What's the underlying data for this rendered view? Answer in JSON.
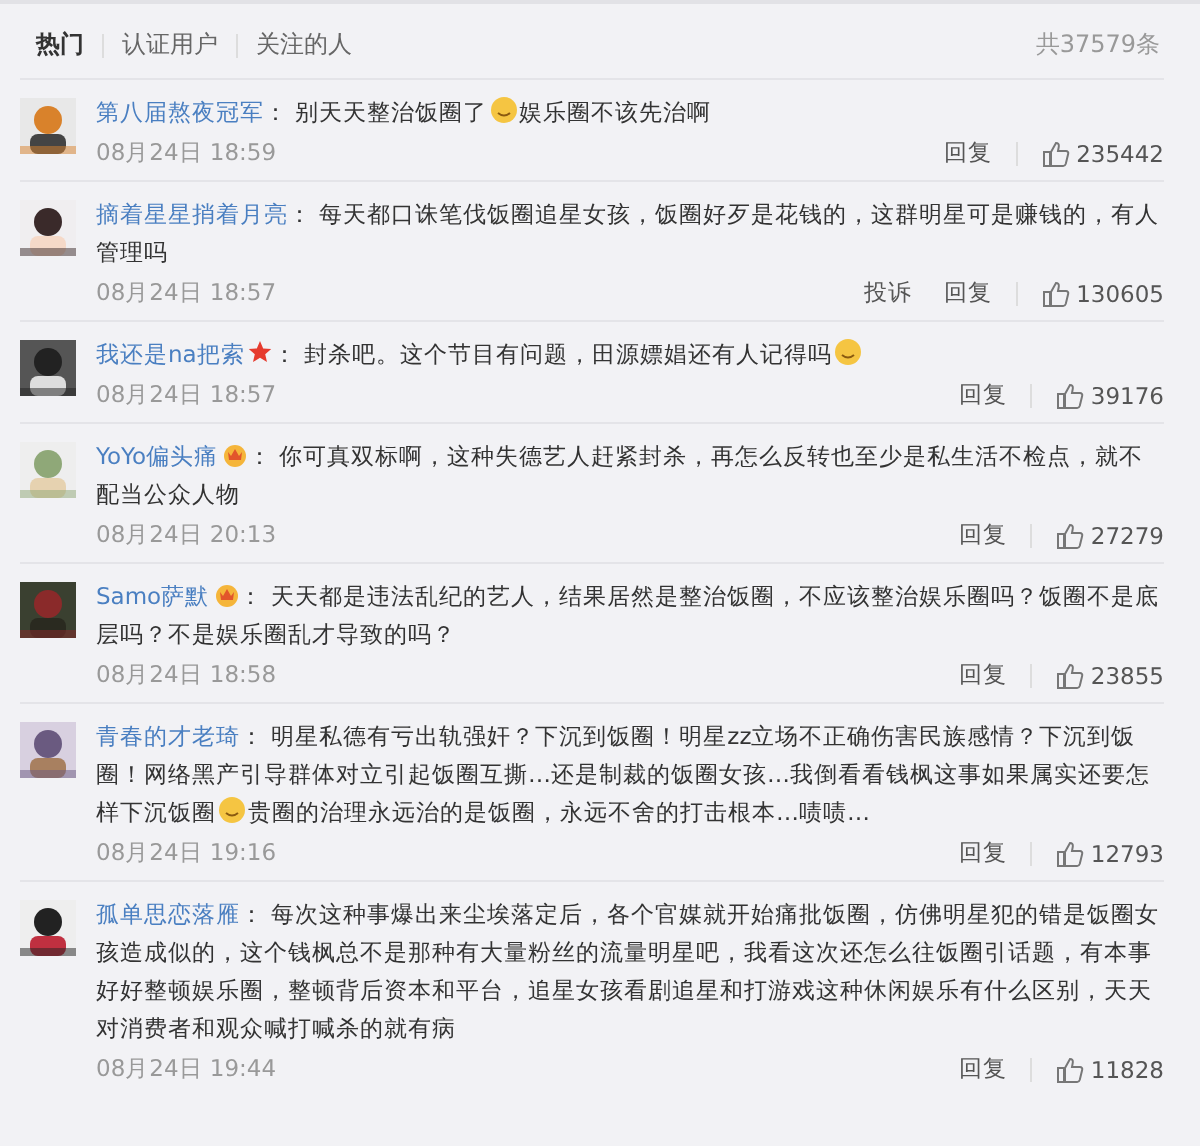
{
  "tabs": [
    {
      "label": "热门",
      "selected": true
    },
    {
      "label": "认证用户",
      "selected": false
    },
    {
      "label": "关注的人",
      "selected": false
    }
  ],
  "total": "共37579条",
  "comments": [
    {
      "user": "第八届熬夜冠军",
      "separator": "：",
      "parts": [
        {
          "kind": "text",
          "text": "别天天整治饭圈了"
        },
        {
          "kind": "emoji"
        },
        {
          "kind": "text",
          "text": "娱乐圈不该先治啊"
        }
      ],
      "time": "08月24日 18:59",
      "actions": [
        "回复"
      ],
      "likes": "235442"
    },
    {
      "user": "摘着星星捎着月亮",
      "separator": "：",
      "parts": [
        {
          "kind": "text",
          "text": "每天都口诛笔伐饭圈追星女孩，饭圈好歹是花钱的，这群明星可是赚钱的，有人管理吗"
        }
      ],
      "time": "08月24日 18:57",
      "actions": [
        "投诉",
        "回复"
      ],
      "likes": "130605"
    },
    {
      "user": "我还是na把索",
      "badge": {
        "kind": "star"
      },
      "separator": "：",
      "parts": [
        {
          "kind": "text",
          "text": "封杀吧。这个节目有问题，田源嫖娼还有人记得吗"
        },
        {
          "kind": "emoji"
        }
      ],
      "time": "08月24日 18:57",
      "actions": [
        "回复"
      ],
      "likes": "39176"
    },
    {
      "user": "YoYo偏头痛",
      "badge": {
        "kind": "crown"
      },
      "separator": "：",
      "parts": [
        {
          "kind": "text",
          "text": "你可真双标啊，这种失德艺人赶紧封杀，再怎么反转也至少是私生活不检点，就不配当公众人物"
        }
      ],
      "time": "08月24日 20:13",
      "actions": [
        "回复"
      ],
      "likes": "27279"
    },
    {
      "user": "Samo萨默",
      "badge": {
        "kind": "crown"
      },
      "separator": "：",
      "parts": [
        {
          "kind": "text",
          "text": "天天都是违法乱纪的艺人，结果居然是整治饭圈，不应该整治娱乐圈吗？饭圈不是底层吗？不是娱乐圈乱才导致的吗？"
        }
      ],
      "time": "08月24日 18:58",
      "actions": [
        "回复"
      ],
      "likes": "23855"
    },
    {
      "user": "青春的才老琦",
      "separator": "：",
      "parts": [
        {
          "kind": "text",
          "text": "明星私德有亏出轨强奸？下沉到饭圈！明星zz立场不正确伤害民族感情？下沉到饭圈！网络黑产引导群体对立引起饭圈互撕…还是制裁的饭圈女孩…我倒看看钱枫这事如果属实还要怎样下沉饭圈"
        },
        {
          "kind": "emoji"
        },
        {
          "kind": "text",
          "text": "贵圈的治理永远治的是饭圈，永远不舍的打击根本…啧啧…"
        }
      ],
      "time": "08月24日 19:16",
      "actions": [
        "回复"
      ],
      "likes": "12793"
    },
    {
      "user": "孤单思恋落雁",
      "separator": "：",
      "parts": [
        {
          "kind": "text",
          "text": "每次这种事爆出来尘埃落定后，各个官媒就开始痛批饭圈，仿佛明星犯的错是饭圈女孩造成似的，这个钱枫总不是那种有大量粉丝的流量明星吧，我看这次还怎么往饭圈引话题，有本事好好整顿娱乐圈，整顿背后资本和平台，追星女孩看剧追星和打游戏这种休闲娱乐有什么区别，天天对消费者和观众喊打喊杀的就有病"
        }
      ],
      "time": "08月24日 19:44",
      "actions": [
        "回复"
      ],
      "likes": "11828"
    }
  ]
}
